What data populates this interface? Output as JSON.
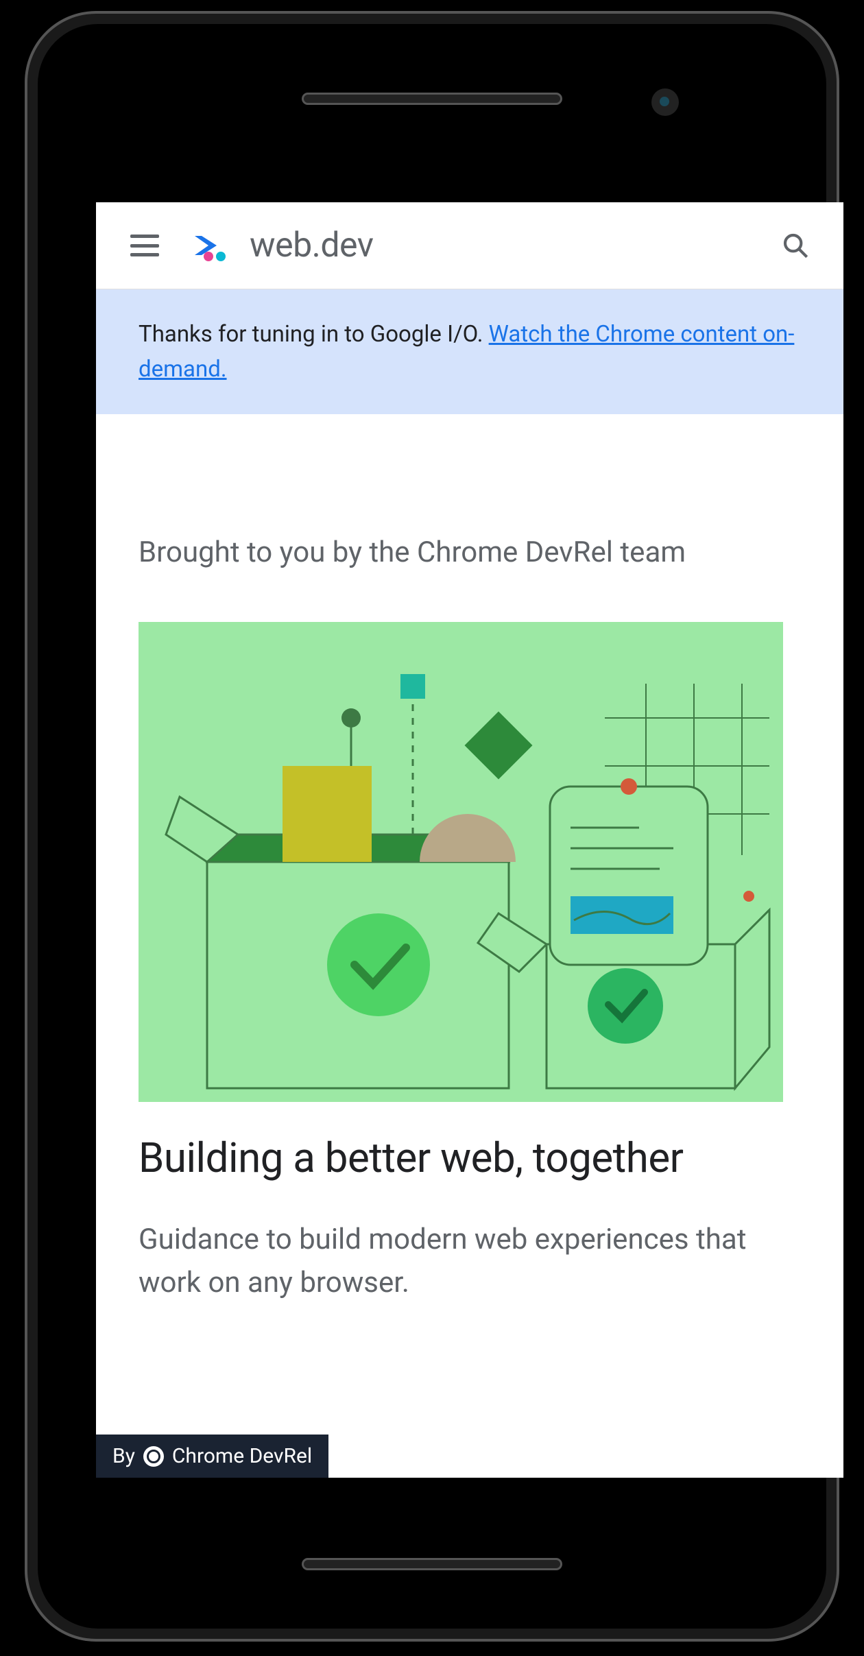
{
  "header": {
    "site_title": "web.dev"
  },
  "banner": {
    "prefix": "Thanks for tuning in to Google I/O. ",
    "link_text": "Watch the Chrome content on-demand."
  },
  "hero": {
    "subtitle": "Brought to you by the Chrome DevRel team",
    "title": "Building a better web, together",
    "description": "Guidance to build modern web experiences that work on any browser."
  },
  "attribution": {
    "prefix": "By",
    "author": "Chrome DevRel"
  }
}
